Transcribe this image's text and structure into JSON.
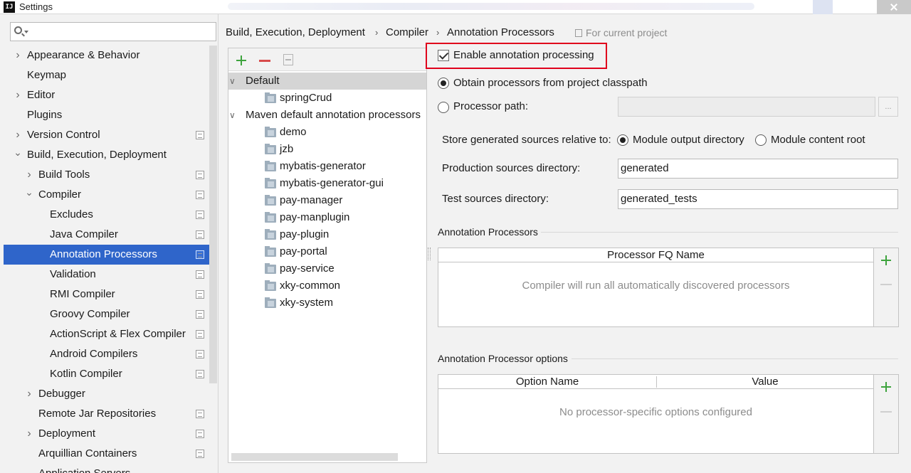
{
  "window": {
    "title": "Settings",
    "app_icon": "IJ"
  },
  "sidebar": {
    "search_placeholder": "",
    "items": [
      {
        "label": "Appearance & Behavior",
        "level": 0,
        "expandable": true,
        "expanded": false,
        "project_icon": false
      },
      {
        "label": "Keymap",
        "level": 0,
        "expandable": false,
        "project_icon": false
      },
      {
        "label": "Editor",
        "level": 0,
        "expandable": true,
        "expanded": false,
        "project_icon": false
      },
      {
        "label": "Plugins",
        "level": 0,
        "expandable": false,
        "project_icon": false
      },
      {
        "label": "Version Control",
        "level": 0,
        "expandable": true,
        "expanded": false,
        "project_icon": true
      },
      {
        "label": "Build, Execution, Deployment",
        "level": 0,
        "expandable": true,
        "expanded": true,
        "project_icon": false
      },
      {
        "label": "Build Tools",
        "level": 1,
        "expandable": true,
        "expanded": false,
        "project_icon": true
      },
      {
        "label": "Compiler",
        "level": 1,
        "expandable": true,
        "expanded": true,
        "project_icon": true
      },
      {
        "label": "Excludes",
        "level": 2,
        "expandable": false,
        "project_icon": true
      },
      {
        "label": "Java Compiler",
        "level": 2,
        "expandable": false,
        "project_icon": true
      },
      {
        "label": "Annotation Processors",
        "level": 2,
        "expandable": false,
        "project_icon": true,
        "selected": true
      },
      {
        "label": "Validation",
        "level": 2,
        "expandable": false,
        "project_icon": true
      },
      {
        "label": "RMI Compiler",
        "level": 2,
        "expandable": false,
        "project_icon": true
      },
      {
        "label": "Groovy Compiler",
        "level": 2,
        "expandable": false,
        "project_icon": true
      },
      {
        "label": "ActionScript & Flex Compiler",
        "level": 2,
        "expandable": false,
        "project_icon": true
      },
      {
        "label": "Android Compilers",
        "level": 2,
        "expandable": false,
        "project_icon": true
      },
      {
        "label": "Kotlin Compiler",
        "level": 2,
        "expandable": false,
        "project_icon": true
      },
      {
        "label": "Debugger",
        "level": 1,
        "expandable": true,
        "expanded": false,
        "project_icon": false
      },
      {
        "label": "Remote Jar Repositories",
        "level": 1,
        "expandable": false,
        "project_icon": true
      },
      {
        "label": "Deployment",
        "level": 1,
        "expandable": true,
        "expanded": false,
        "project_icon": true
      },
      {
        "label": "Arquillian Containers",
        "level": 1,
        "expandable": false,
        "project_icon": true
      },
      {
        "label": "Application Servers",
        "level": 1,
        "expandable": false,
        "project_icon": false
      }
    ]
  },
  "breadcrumb": {
    "parts": [
      "Build, Execution, Deployment",
      "Compiler",
      "Annotation Processors"
    ],
    "separator": "›",
    "scope": "For current project"
  },
  "profiles": {
    "rows": [
      {
        "label": "Default",
        "type": "group",
        "highlighted": true
      },
      {
        "label": "springCrud",
        "type": "module"
      },
      {
        "label": "Maven default annotation processors",
        "type": "group"
      },
      {
        "label": "demo",
        "type": "module"
      },
      {
        "label": "jzb",
        "type": "module"
      },
      {
        "label": "mybatis-generator",
        "type": "module"
      },
      {
        "label": "mybatis-generator-gui",
        "type": "module"
      },
      {
        "label": "pay-manager",
        "type": "module"
      },
      {
        "label": "pay-manplugin",
        "type": "module"
      },
      {
        "label": "pay-plugin",
        "type": "module"
      },
      {
        "label": "pay-portal",
        "type": "module"
      },
      {
        "label": "pay-service",
        "type": "module"
      },
      {
        "label": "xky-common",
        "type": "module"
      },
      {
        "label": "xky-system",
        "type": "module"
      }
    ]
  },
  "settings": {
    "enable_label": "Enable annotation processing",
    "enable_checked": true,
    "obtain_label": "Obtain processors from project classpath",
    "processor_path_label": "Processor path:",
    "processor_path_value": "",
    "browse_label": "...",
    "store_label": "Store generated sources relative to:",
    "module_output_label": "Module output directory",
    "module_content_label": "Module content root",
    "production_label": "Production sources directory:",
    "production_value": "generated",
    "test_label": "Test sources directory:",
    "test_value": "generated_tests"
  },
  "processors_table": {
    "group_title": "Annotation Processors",
    "column": "Processor FQ Name",
    "empty_text": "Compiler will run all automatically discovered processors"
  },
  "options_table": {
    "group_title": "Annotation Processor options",
    "columns": [
      "Option Name",
      "Value"
    ],
    "empty_text": "No processor-specific options configured"
  },
  "colors": {
    "selection": "#2f65ca",
    "highlight_box": "#e0001c",
    "add_green": "#3da33d",
    "remove_red": "#d84b4b"
  }
}
